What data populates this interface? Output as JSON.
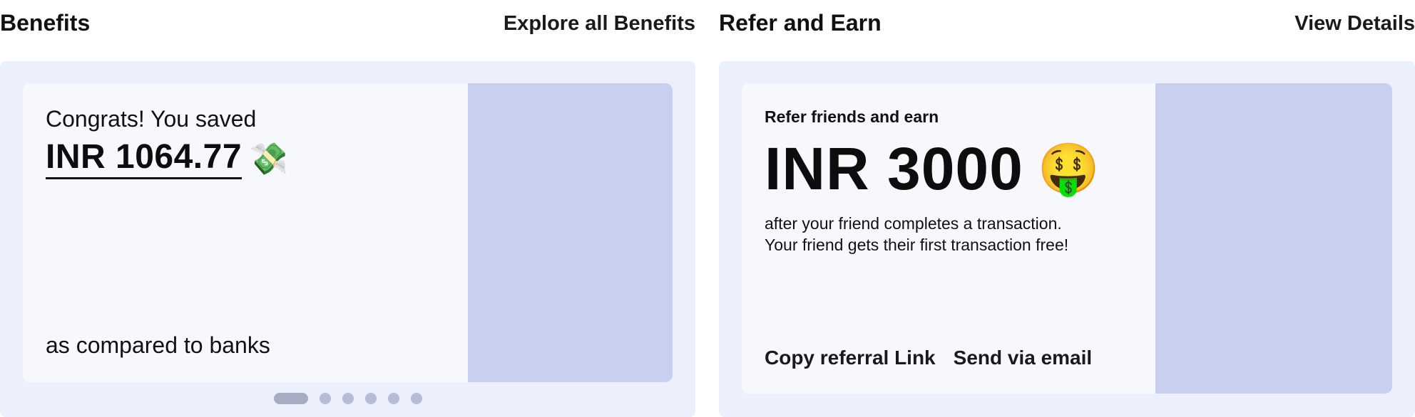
{
  "benefits": {
    "title": "Benefits",
    "explore_link": "Explore all Benefits",
    "card": {
      "congrats_text": "Congrats! You saved",
      "amount": "INR 1064.77",
      "amount_emoji": "💸",
      "subtext": "as compared to banks"
    },
    "carousel": {
      "total": 6,
      "active_index": 0
    }
  },
  "refer": {
    "title": "Refer and Earn",
    "details_link": "View Details",
    "card": {
      "subtitle": "Refer friends and earn",
      "amount": "INR 3000",
      "amount_emoji": "🤑",
      "desc_line1": "after your friend completes a transaction.",
      "desc_line2": "Your friend gets their first transaction free!",
      "copy_link_label": "Copy referral Link",
      "send_email_label": "Send via email"
    }
  },
  "colors": {
    "panel_bg": "#eceffc",
    "card_bg": "#f7f8fd",
    "image_placeholder": "#c8d0ef",
    "dot": "#b6bdd6",
    "dot_active": "#a7aec4"
  }
}
